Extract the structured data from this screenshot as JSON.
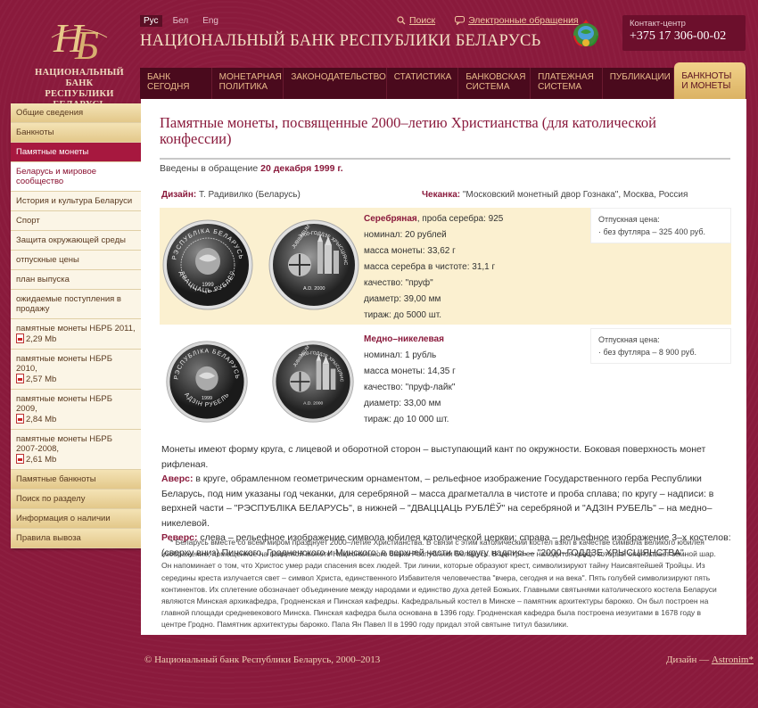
{
  "header": {
    "logo_text_line1": "НАЦИОНАЛЬНЫЙ БАНК",
    "logo_text_line2": "РЕСПУБЛИКИ БЕЛАРУСЬ",
    "langs": [
      "Рус",
      "Бел",
      "Eng"
    ],
    "search_link": "Поиск",
    "appeals_link": "Электронные обращения",
    "site_title": "НАЦИОНАЛЬНЫЙ БАНК РЕСПУБЛИКИ БЕЛАРУСЬ",
    "contact_label": "Контакт-центр",
    "contact_phone": "+375 17 306-00-02"
  },
  "nav": [
    {
      "l1": "БАНК",
      "l2": "СЕГОДНЯ"
    },
    {
      "l1": "МОНЕТАРНАЯ",
      "l2": "ПОЛИТИКА"
    },
    {
      "l1": "ЗАКОНОДАТЕЛЬСТВО",
      "l2": ""
    },
    {
      "l1": "СТАТИСТИКА",
      "l2": ""
    },
    {
      "l1": "БАНКОВСКАЯ",
      "l2": "СИСТЕМА"
    },
    {
      "l1": "ПЛАТЕЖНАЯ",
      "l2": "СИСТЕМА"
    },
    {
      "l1": "ПУБЛИКАЦИИ",
      "l2": ""
    },
    {
      "l1": "БАНКНОТЫ",
      "l2": "И МОНЕТЫ"
    }
  ],
  "sidebar": [
    "Общие сведения",
    "Банкноты",
    "Памятные монеты",
    "Беларусь и мировое сообщество",
    "История и культура Беларуси",
    "Спорт",
    "Защита окружающей среды",
    "отпускные цены",
    "план выпуска",
    "ожидаемые поступления в продажу",
    "памятные монеты НБРБ 2011,",
    "2,29 Mb",
    "памятные монеты НБРБ 2010,",
    "2,57 Mb",
    "памятные монеты НБРБ 2009,",
    "2,84 Mb",
    "памятные монеты НБРБ 2007-2008,",
    "2,61 Mb",
    "Памятные банкноты",
    "Поиск по разделу",
    "Информация о наличии",
    "Правила вывоза"
  ],
  "main": {
    "title": "Памятные монеты, посвященные 2000–летию Христианства (для католической конфессии)",
    "intro_prefix": "Введены в обращение",
    "intro_date": "20 декабря 1999 г.",
    "design_label": "Дизайн:",
    "design_value": "Т. Радивилко (Беларусь)",
    "mint_label": "Чеканка:",
    "mint_value": "\"Московский монетный двор Гознака\", Москва, Россия",
    "silver": {
      "title": "Серебряная",
      "title_rest": ", проба серебра: 925",
      "specs": [
        "номинал: 20 рублей",
        "масса монеты: 33,62 г",
        "масса серебра в чистоте: 31,1 г",
        "качество: \"пруф\"",
        "диаметр: 39,00 мм",
        "тираж: до 5000 шт."
      ],
      "price_label": "Отпускная цена:",
      "price_value": "· без футляра – 325 400 руб."
    },
    "copper": {
      "title": "Медно–никелевая",
      "specs": [
        "номинал: 1 рубль",
        "масса монеты: 14,35 г",
        "качество: \"пруф-лайк\"",
        "диаметр: 33,00 мм",
        "тираж: до 10 000 шт."
      ],
      "price_label": "Отпускная цена:",
      "price_value": "· без футляра – 8 900 руб."
    },
    "desc1": "Монеты имеют форму круга, с лицевой и оборотной сторон – выступающий кант по окружности. Боковая поверхность монет рифленая.",
    "avers_label": "Аверс:",
    "avers_text": " в круге, обрамленном геометрическим орнаментом, – рельефное изображение Государственного герба Республики Беларусь, под ним указаны год чеканки, для серебряной – масса драгметалла в чистоте и проба сплава; по кругу – надписи: в верхней части – \"РЭСПУБЛІКА БЕЛАРУСЬ\", в нижней – \"ДВАЦЦАЦЬ РУБЛЁЎ\" на серебряной и \"АДЗІН РУБЕЛЬ\" – на медно–никелевой.",
    "revers_label": "Реверс:",
    "revers_text": " слева – рельефное изображение символа юбилея католической церкви; справа – рельефное изображение 3–х костелов: (сверху вниз) Пинского, Гродненского и Минского; в верхней части по кругу надпись – \"2000–ГОДДЗЕ ХРЫСЦІЯНСТВА\".",
    "note": "* Беларусь вместе со всем миром празднует 2000–летие Христианства. В связи с этим католический костёл взял в качестве символа великого юбилея изображение, помещенное на памятной монете Национального банка Республики Беларусь. В центре ее находится крест, который опоясывает земной шар. Он напоминает о том, что Христос умер ради спасения всех людей. Три линии, которые образуют крест, символизируют тайну Наисвятейшей Тройцы. Из середины креста излучается свет – символ Христа, единственного Избавителя человечества \"вчера, сегодня и на века\". Пять голубей символизируют пять континентов. Их сплетение обозначает объединение между народами и единство духа детей Божьих. Главными святынями католического костела Беларуси являются Минская архикафедра, Гродненская и Пинская кафедры. Кафедральный костел в Минске – памятник архитектуры барокко. Он был построен на главной площади средневекового Минска. Пинская кафедра была основана в 1396 году. Гродненская кафедра была построена иезуитами в 1678 году в центре Гродно. Памятник архитектуры барокко. Папа Ян Павел II в 1990 году придал этой святыне титул базилики."
  },
  "coins": {
    "silver_obverse_top": "РЭСПУБЛІКА БЕЛАРУСЬ",
    "silver_obverse_bottom": "ДВАЦЦАЦЬ РУБЛЁЎ",
    "silver_obverse_year": "1999",
    "silver_reverse_top": "2000-ГОДДЗЕ ХРЫСЦІЯНСТВА",
    "silver_reverse_side": "JUBILAEUM",
    "silver_reverse_bottom": "A.D. 2000",
    "copper_obverse_top": "РЭСПУБЛІКА БЕЛАРУСЬ",
    "copper_obverse_bottom": "АДЗІН РУБЕЛЬ",
    "copper_obverse_year": "1999",
    "copper_reverse_top": "2000-ГОДДЗЕ ХРЫСЦІЯНСТВА",
    "copper_reverse_side": "JUBILAEUM",
    "copper_reverse_bottom": "A.D. 2000"
  },
  "footer": {
    "copyright": "© Национальный банк Республики Беларусь, 2000–2013",
    "design_prefix": "Дизайн — ",
    "design_link": "Astronim*"
  }
}
